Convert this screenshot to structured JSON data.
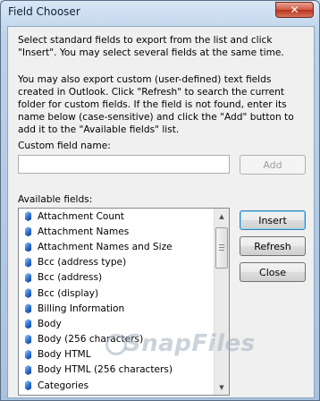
{
  "window": {
    "title": "Field Chooser",
    "close_glyph": "✕"
  },
  "instructions": {
    "line1": "Select standard fields to export from the list and click \"Insert\". You may select several fields at the same time.",
    "line2": "You may also export custom (user-defined) text fields created in Outlook. Click \"Refresh\" to search the current folder for custom fields. If the field is not found, enter its name below (case-sensitive) and click the \"Add\" button to add it to the \"Available fields\" list."
  },
  "custom_field": {
    "label": "Custom field name:",
    "value": "",
    "add_label": "Add"
  },
  "available_fields": {
    "label": "Available fields:",
    "items": [
      "Attachment Count",
      "Attachment Names",
      "Attachment Names and Size",
      "Bcc (address type)",
      "Bcc (address)",
      "Bcc (display)",
      "Billing Information",
      "Body",
      "Body (256 characters)",
      "Body HTML",
      "Body HTML (256 characters)",
      "Categories"
    ]
  },
  "buttons": {
    "insert": "Insert",
    "refresh": "Refresh",
    "close": "Close"
  },
  "watermark": {
    "text": "SnapFiles"
  }
}
